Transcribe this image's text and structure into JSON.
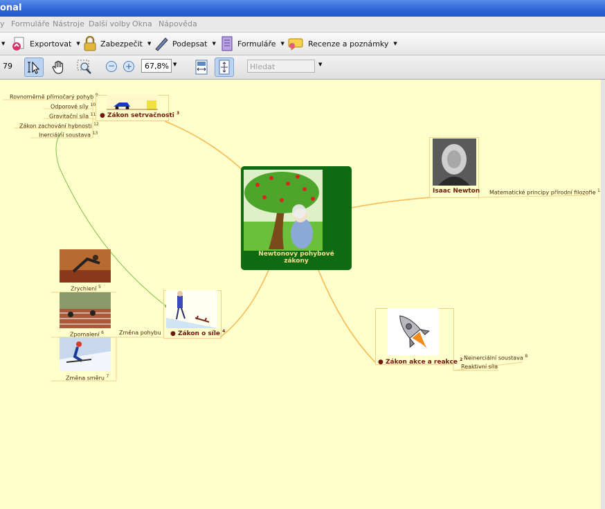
{
  "window": {
    "title_fragment": "onal"
  },
  "menu": {
    "items": [
      "y",
      "Formuláře",
      "Nástroje",
      "Další volby",
      "Okna",
      "Nápověda"
    ]
  },
  "toolbar": {
    "export": "Exportovat",
    "secure": "Zabezpečit",
    "sign": "Podepsat",
    "forms": "Formuláře",
    "review": "Recenze a poznámky"
  },
  "nav": {
    "page_number": "79",
    "zoom": "67,8%",
    "search_placeholder": "Hledat"
  },
  "mindmap": {
    "center": {
      "line1": "Newtonovy pohybové",
      "line2": "zákony"
    },
    "newton": {
      "label": "Isaac Newton",
      "child": "Matematické principy přírodní filozofie",
      "child_num": "1"
    },
    "inertia": {
      "label": "Zákon setrvačnosti",
      "num": "3",
      "children": [
        {
          "text": "Rovnoměrně přímočarý pohyb",
          "num": "9"
        },
        {
          "text": "Odporové síly",
          "num": "10"
        },
        {
          "text": "Gravitační síla",
          "num": "11"
        },
        {
          "text": "Zákon zachování hybnosti",
          "num": "12"
        },
        {
          "text": "Inerciální soustava",
          "num": "13"
        }
      ]
    },
    "force": {
      "label": "Zákon o síle",
      "num": "4",
      "child": "Změna pohybu",
      "sub": [
        {
          "text": "Zrychlení",
          "num": "5"
        },
        {
          "text": "Zpomalení",
          "num": "6"
        },
        {
          "text": "Změna směru",
          "num": "7"
        }
      ]
    },
    "action": {
      "label": "Zákon akce a reakce",
      "num": "2",
      "children": [
        {
          "text": "Neinerciální soustava",
          "num": "8"
        },
        {
          "text": "Reaktivní síla",
          "num": ""
        }
      ]
    }
  },
  "colors": {
    "canvas": "#ffffcc",
    "center_bg": "#0f6b12",
    "branch": "#f5c060",
    "link": "#7ac047",
    "label": "#6b1a0a"
  }
}
